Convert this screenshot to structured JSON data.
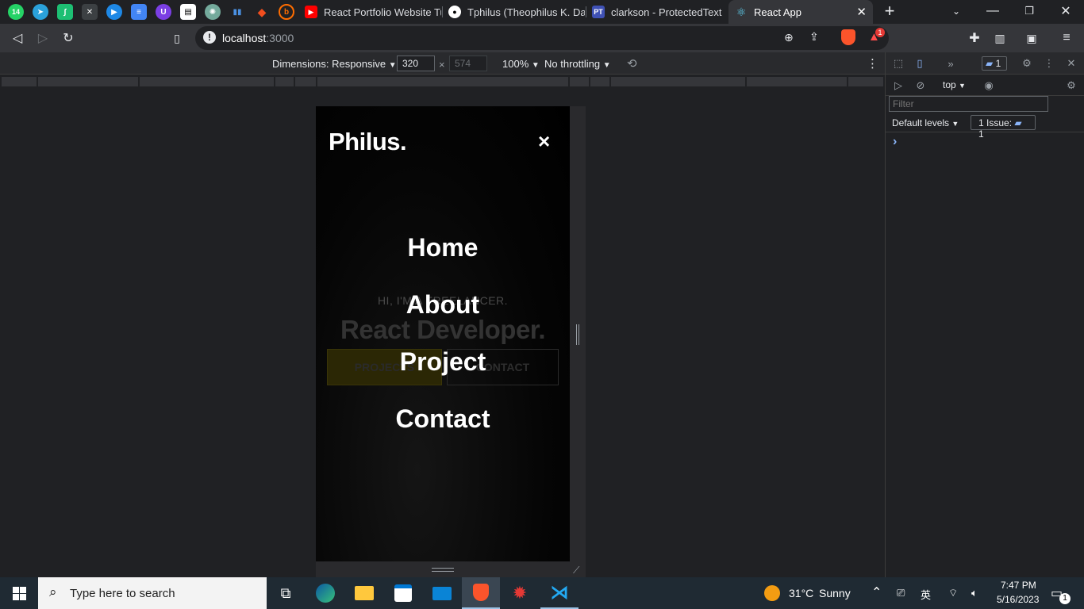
{
  "browser": {
    "pinned_tabs": [
      {
        "icon": "whatsapp-icon",
        "badge": "14",
        "color": "#25d366"
      },
      {
        "icon": "telegram-icon",
        "color": "#2aa1da"
      },
      {
        "icon": "app-icon",
        "color": "#1dbf73"
      },
      {
        "icon": "tool-icon",
        "color": "#3c4043"
      },
      {
        "icon": "play-icon",
        "color": "#1e88e5"
      },
      {
        "icon": "docs-icon",
        "color": "#4285f4"
      },
      {
        "icon": "app-icon",
        "color": "#7b3fe4"
      },
      {
        "icon": "news-icon",
        "color": "#ffffff"
      },
      {
        "icon": "chatgpt-icon",
        "color": "#74aa9c"
      },
      {
        "icon": "chart-icon",
        "color": "#4a90e2"
      },
      {
        "icon": "figma-icon",
        "color": "#f24e1e"
      },
      {
        "icon": "b-icon",
        "color": "#ff6d00"
      }
    ],
    "tabs": [
      {
        "title": "React Portfolio Website Tut",
        "icon": "youtube-icon",
        "color": "#ff0000"
      },
      {
        "title": "Tphilus (Theophilus K. Dadz",
        "icon": "github-icon",
        "color": "#ffffff"
      },
      {
        "title": "clarkson - ProtectedText",
        "icon": "pt-icon",
        "color": "#3f51b5",
        "fav_text": "PT"
      },
      {
        "title": "React App",
        "icon": "react-icon",
        "color": "#61dafb",
        "active": true
      }
    ],
    "url_host": "localhost",
    "url_port": ":3000",
    "brave_badge": "1"
  },
  "device_toolbar": {
    "dimensions_label": "Dimensions: Responsive",
    "width": "320",
    "height": "574",
    "times": "×",
    "zoom": "100%",
    "throttling": "No throttling"
  },
  "page": {
    "logo": "Philus.",
    "close": "×",
    "nav": [
      "Home",
      "About",
      "Project",
      "Contact"
    ],
    "hero_sub": "HI, I'M A FREELANCER.",
    "hero_title": "React Developer.",
    "btn_project": "PROJECTS",
    "btn_contact": "CONTACT"
  },
  "devtools": {
    "issues_count": "1",
    "context": "top",
    "filter_placeholder": "Filter",
    "levels": "Default levels",
    "issue_label": "1 Issue:",
    "issue_count": "1",
    "prompt": "›"
  },
  "taskbar": {
    "search_placeholder": "Type here to search",
    "weather_temp": "31°C",
    "weather_desc": "Sunny",
    "time": "7:47 PM",
    "date": "5/16/2023",
    "notif_count": "1"
  }
}
